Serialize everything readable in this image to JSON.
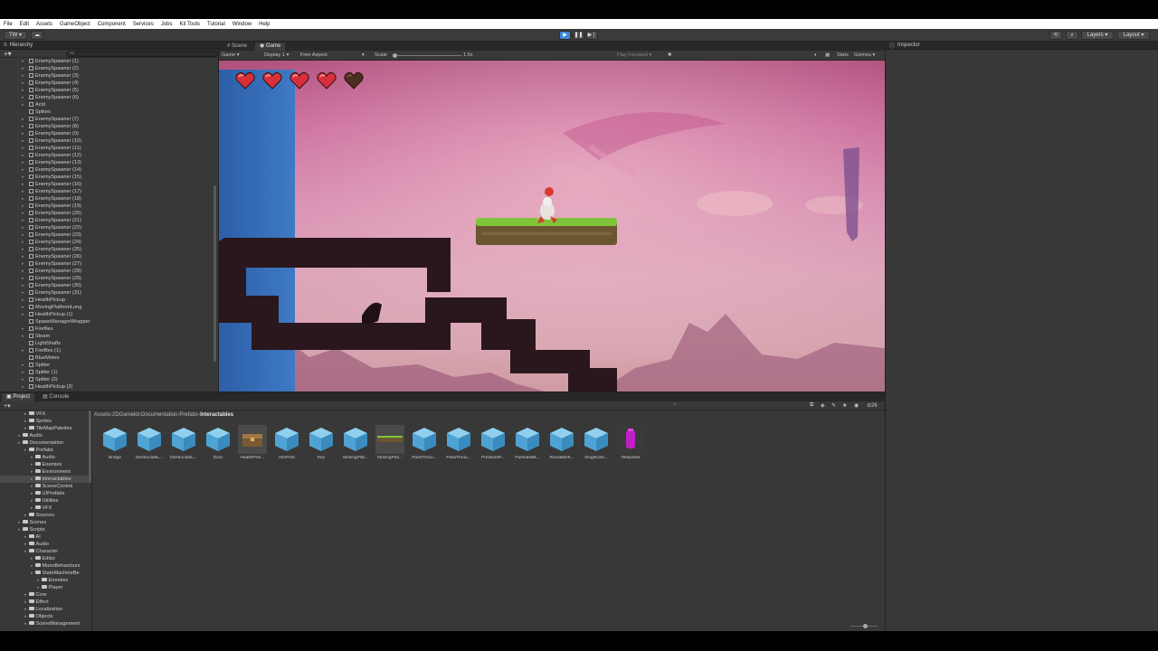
{
  "menu": [
    "File",
    "Edit",
    "Assets",
    "GameObject",
    "Component",
    "Services",
    "Jobs",
    "Kit Tools",
    "Tutorial",
    "Window",
    "Help"
  ],
  "toolbar": {
    "account": "TW",
    "layers": "Layers",
    "layout": "Layout"
  },
  "hierarchy": {
    "title": "Hierarchy",
    "search_placeholder": "All",
    "items": [
      {
        "label": "EnemySpawner (1)",
        "arrow": true
      },
      {
        "label": "EnemySpawner (2)",
        "arrow": true
      },
      {
        "label": "EnemySpawner (3)",
        "arrow": true
      },
      {
        "label": "EnemySpawner (4)",
        "arrow": true
      },
      {
        "label": "EnemySpawner (5)",
        "arrow": true
      },
      {
        "label": "EnemySpawner (6)",
        "arrow": true
      },
      {
        "label": "Acid",
        "arrow": true
      },
      {
        "label": "Spikes",
        "arrow": false
      },
      {
        "label": "EnemySpawner (7)",
        "arrow": true
      },
      {
        "label": "EnemySpawner (8)",
        "arrow": true
      },
      {
        "label": "EnemySpawner (9)",
        "arrow": true
      },
      {
        "label": "EnemySpawner (10)",
        "arrow": true
      },
      {
        "label": "EnemySpawner (11)",
        "arrow": true
      },
      {
        "label": "EnemySpawner (12)",
        "arrow": true
      },
      {
        "label": "EnemySpawner (13)",
        "arrow": true
      },
      {
        "label": "EnemySpawner (14)",
        "arrow": true
      },
      {
        "label": "EnemySpawner (15)",
        "arrow": true
      },
      {
        "label": "EnemySpawner (16)",
        "arrow": true
      },
      {
        "label": "EnemySpawner (17)",
        "arrow": true
      },
      {
        "label": "EnemySpawner (18)",
        "arrow": true
      },
      {
        "label": "EnemySpawner (19)",
        "arrow": true
      },
      {
        "label": "EnemySpawner (20)",
        "arrow": true
      },
      {
        "label": "EnemySpawner (21)",
        "arrow": true
      },
      {
        "label": "EnemySpawner (22)",
        "arrow": true
      },
      {
        "label": "EnemySpawner (23)",
        "arrow": true
      },
      {
        "label": "EnemySpawner (24)",
        "arrow": true
      },
      {
        "label": "EnemySpawner (25)",
        "arrow": true
      },
      {
        "label": "EnemySpawner (26)",
        "arrow": true
      },
      {
        "label": "EnemySpawner (27)",
        "arrow": true
      },
      {
        "label": "EnemySpawner (28)",
        "arrow": true
      },
      {
        "label": "EnemySpawner (29)",
        "arrow": true
      },
      {
        "label": "EnemySpawner (30)",
        "arrow": true
      },
      {
        "label": "EnemySpawner (31)",
        "arrow": true
      },
      {
        "label": "HealthPickup",
        "arrow": true
      },
      {
        "label": "MovingPlatformLong",
        "arrow": true
      },
      {
        "label": "HealthPickup (1)",
        "arrow": true
      },
      {
        "label": "SpawnManagerWrapper",
        "arrow": false
      },
      {
        "label": "Fireflies",
        "arrow": true
      },
      {
        "label": "Steam",
        "arrow": true
      },
      {
        "label": "LightShafts",
        "arrow": false
      },
      {
        "label": "Fireflies (1)",
        "arrow": true
      },
      {
        "label": "BlueMotes",
        "arrow": false
      },
      {
        "label": "Spitter",
        "arrow": true
      },
      {
        "label": "Spitter (1)",
        "arrow": true
      },
      {
        "label": "Spitter (2)",
        "arrow": true
      },
      {
        "label": "HealthPickup (2)",
        "arrow": true
      }
    ]
  },
  "game": {
    "tabs": [
      "Scene",
      "Game"
    ],
    "display_mode": "Game",
    "display": "Display 1",
    "aspect": "Free Aspect",
    "scale_label": "Scale",
    "scale_value": "1.5x",
    "play_focused": "Play Focused",
    "stats": "Stats",
    "gizmos": "Gizmos",
    "health_hearts": 5,
    "full_hearts": 4
  },
  "inspector": {
    "title": "Inspector"
  },
  "bottom_tabs": [
    "Project",
    "Console"
  ],
  "project": {
    "breadcrumb": [
      "Assets",
      "2DGamekit",
      "Documentation",
      "Prefabs",
      "Interactables"
    ],
    "item_count": "26",
    "tree": [
      {
        "label": "VFX",
        "indent": 1,
        "sel": false
      },
      {
        "label": "Sprites",
        "indent": 1,
        "sel": false
      },
      {
        "label": "TileMapPalettes",
        "indent": 1,
        "sel": false
      },
      {
        "label": "Audio",
        "indent": 0,
        "sel": false
      },
      {
        "label": "Documentation",
        "indent": 0,
        "sel": false
      },
      {
        "label": "Prefabs",
        "indent": 1,
        "sel": false
      },
      {
        "label": "Audio",
        "indent": 2,
        "sel": false
      },
      {
        "label": "Enemies",
        "indent": 2,
        "sel": false
      },
      {
        "label": "Environment",
        "indent": 2,
        "sel": false
      },
      {
        "label": "Interactables",
        "indent": 2,
        "sel": true
      },
      {
        "label": "SceneControl",
        "indent": 2,
        "sel": false
      },
      {
        "label": "UIPrefabs",
        "indent": 2,
        "sel": false
      },
      {
        "label": "Utilities",
        "indent": 2,
        "sel": false
      },
      {
        "label": "VFX",
        "indent": 2,
        "sel": false
      },
      {
        "label": "Sources",
        "indent": 1,
        "sel": false
      },
      {
        "label": "Scenes",
        "indent": 0,
        "sel": false
      },
      {
        "label": "Scripts",
        "indent": 0,
        "sel": false
      },
      {
        "label": "AI",
        "indent": 1,
        "sel": false
      },
      {
        "label": "Audio",
        "indent": 1,
        "sel": false
      },
      {
        "label": "Character",
        "indent": 1,
        "sel": false
      },
      {
        "label": "Editor",
        "indent": 2,
        "sel": false
      },
      {
        "label": "MonoBehaviours",
        "indent": 2,
        "sel": false
      },
      {
        "label": "StateMachineBe",
        "indent": 2,
        "sel": false
      },
      {
        "label": "Enemies",
        "indent": 3,
        "sel": false
      },
      {
        "label": "Player",
        "indent": 3,
        "sel": false
      },
      {
        "label": "Core",
        "indent": 1,
        "sel": false
      },
      {
        "label": "Effect",
        "indent": 1,
        "sel": false
      },
      {
        "label": "Localization",
        "indent": 1,
        "sel": false
      },
      {
        "label": "Objects",
        "indent": 1,
        "sel": false
      },
      {
        "label": "SceneManagement",
        "indent": 1,
        "sel": false
      }
    ],
    "assets": [
      {
        "label": "Bridge",
        "kind": "cube"
      },
      {
        "label": "DestructabL...",
        "kind": "cube"
      },
      {
        "label": "DestructabL...",
        "kind": "cube"
      },
      {
        "label": "Door",
        "kind": "cube"
      },
      {
        "label": "HealthPick...",
        "kind": "chest"
      },
      {
        "label": "InfoPost",
        "kind": "cube"
      },
      {
        "label": "Key",
        "kind": "cube"
      },
      {
        "label": "MovingPlat...",
        "kind": "cube"
      },
      {
        "label": "MovingPlat...",
        "kind": "platform"
      },
      {
        "label": "PassThrou...",
        "kind": "cube"
      },
      {
        "label": "PassThrou...",
        "kind": "cube"
      },
      {
        "label": "PressureP...",
        "kind": "cube"
      },
      {
        "label": "PushableB...",
        "kind": "cube"
      },
      {
        "label": "Reusable5...",
        "kind": "cube"
      },
      {
        "label": "SingleUse...",
        "kind": "cube"
      },
      {
        "label": "Teleporter",
        "kind": "teleporter"
      }
    ]
  },
  "colors": {
    "accent": "#3d87d6",
    "panel": "#383838",
    "header": "#282828",
    "heart": "#d8303a"
  }
}
